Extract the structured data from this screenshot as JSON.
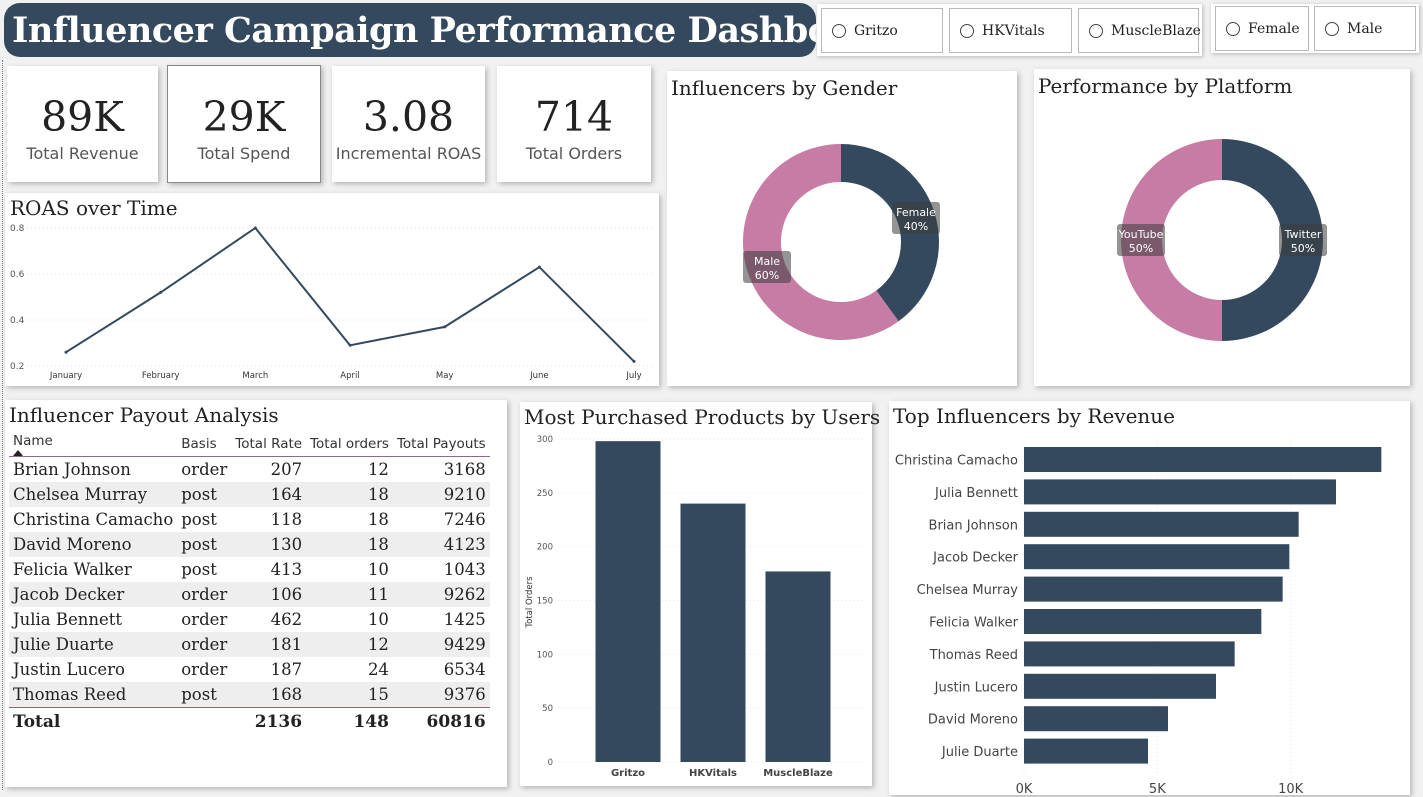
{
  "title": "Influencer Campaign Performance Dashboard",
  "slicers": {
    "products": [
      "Gritzo",
      "HKVitals",
      "MuscleBlaze"
    ],
    "genders": [
      "Female",
      "Male"
    ]
  },
  "kpis": [
    {
      "value": "89K",
      "label": "Total Revenue"
    },
    {
      "value": "29K",
      "label": "Total Spend"
    },
    {
      "value": "3.08",
      "label": "Incremental ROAS"
    },
    {
      "value": "714",
      "label": "Total Orders"
    }
  ],
  "colors": {
    "dark": "#34495e",
    "pink": "#c77ca6",
    "title_bg": "#34495e"
  },
  "roas_chart": {
    "title": "ROAS over Time",
    "y_ticks": [
      "0.8",
      "0.6",
      "0.4",
      "0.2"
    ]
  },
  "gender_chart": {
    "title": "Influencers by Gender"
  },
  "platform_chart": {
    "title": "Performance by Platform"
  },
  "payout": {
    "title": "Influencer Payout Analysis",
    "headers": [
      "Name",
      "Basis",
      "Total Rate",
      "Total orders",
      "Total Payouts"
    ],
    "rows": [
      [
        "Brian Johnson",
        "order",
        "207",
        "12",
        "3168"
      ],
      [
        "Chelsea Murray",
        "post",
        "164",
        "18",
        "9210"
      ],
      [
        "Christina Camacho",
        "post",
        "118",
        "18",
        "7246"
      ],
      [
        "David Moreno",
        "post",
        "130",
        "18",
        "4123"
      ],
      [
        "Felicia Walker",
        "post",
        "413",
        "10",
        "1043"
      ],
      [
        "Jacob Decker",
        "order",
        "106",
        "11",
        "9262"
      ],
      [
        "Julia Bennett",
        "order",
        "462",
        "10",
        "1425"
      ],
      [
        "Julie Duarte",
        "order",
        "181",
        "12",
        "9429"
      ],
      [
        "Justin Lucero",
        "order",
        "187",
        "24",
        "6534"
      ],
      [
        "Thomas Reed",
        "post",
        "168",
        "15",
        "9376"
      ]
    ],
    "total": {
      "label": "Total",
      "rate": "2136",
      "orders": "148",
      "payouts": "60816"
    }
  },
  "products_chart": {
    "title": "Most Purchased Products by Users"
  },
  "influencers_chart": {
    "title": "Top Influencers by Revenue"
  },
  "chart_data": [
    {
      "type": "line",
      "title": "ROAS over Time",
      "x": [
        "January",
        "February",
        "March",
        "April",
        "May",
        "June",
        "July"
      ],
      "values": [
        0.26,
        0.52,
        0.8,
        0.29,
        0.37,
        0.63,
        0.22
      ],
      "ylim": [
        0.2,
        0.8
      ],
      "y_ticks": [
        0.2,
        0.4,
        0.6,
        0.8
      ],
      "grid": true
    },
    {
      "type": "pie",
      "donut": true,
      "title": "Influencers by Gender",
      "slices": [
        {
          "label": "Female",
          "value": 40,
          "display": "40%",
          "color": "#34495e"
        },
        {
          "label": "Male",
          "value": 60,
          "display": "60%",
          "color": "#c77ca6"
        }
      ]
    },
    {
      "type": "pie",
      "donut": true,
      "title": "Performance by Platform",
      "slices": [
        {
          "label": "Twitter",
          "value": 50,
          "display": "50%",
          "color": "#34495e"
        },
        {
          "label": "YouTube",
          "value": 50,
          "display": "50%",
          "color": "#c77ca6"
        }
      ]
    },
    {
      "type": "bar",
      "title": "Most Purchased Products by Users",
      "categories": [
        "Gritzo",
        "HKVitals",
        "MuscleBlaze"
      ],
      "values": [
        298,
        240,
        177
      ],
      "ylabel": "Total Orders",
      "ylim": [
        0,
        300
      ],
      "y_ticks": [
        0,
        50,
        100,
        150,
        200,
        250,
        300
      ],
      "grid": true
    },
    {
      "type": "bar",
      "orientation": "horizontal",
      "title": "Top Influencers by Revenue",
      "categories": [
        "Christina Camacho",
        "Julia Bennett",
        "Brian Johnson",
        "Jacob Decker",
        "Chelsea Murray",
        "Felicia Walker",
        "Thomas Reed",
        "Justin Lucero",
        "David Moreno",
        "Julie Duarte"
      ],
      "values": [
        13400,
        11700,
        10300,
        9950,
        9700,
        8900,
        7900,
        7200,
        5400,
        4650
      ],
      "xlim": [
        0,
        15000
      ],
      "x_ticks": [
        0,
        5000,
        10000
      ],
      "x_tick_labels": [
        "0K",
        "5K",
        "10K"
      ],
      "grid": true
    }
  ]
}
